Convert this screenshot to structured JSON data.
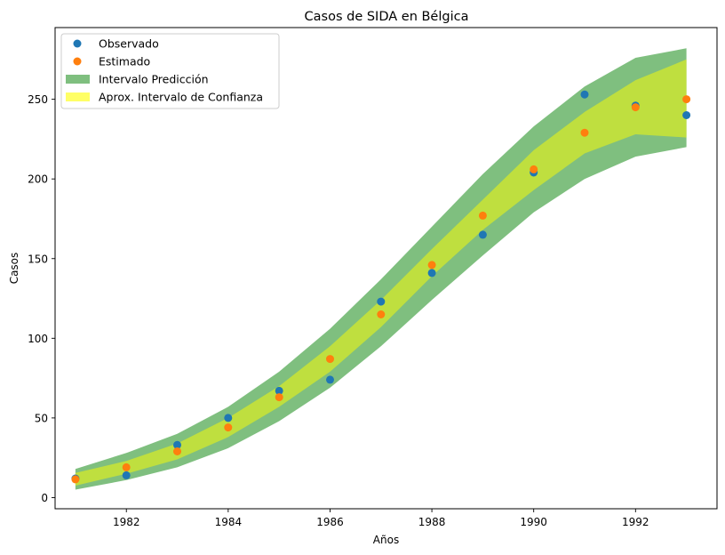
{
  "chart_data": {
    "type": "scatter",
    "title": "Casos de SIDA en Bélgica",
    "xlabel": "Años",
    "ylabel": "Casos",
    "xlim": [
      1980.6,
      1993.6
    ],
    "ylim": [
      -7,
      295
    ],
    "xticks": [
      1982,
      1984,
      1986,
      1988,
      1990,
      1992
    ],
    "yticks": [
      0,
      50,
      100,
      150,
      200,
      250
    ],
    "grid": false,
    "legend_position": "top-left",
    "x": [
      1981,
      1982,
      1983,
      1984,
      1985,
      1986,
      1987,
      1988,
      1989,
      1990,
      1991,
      1992,
      1993
    ],
    "series": [
      {
        "name": "Observado",
        "kind": "points",
        "color": "#1f77b4",
        "values": [
          12,
          14,
          33,
          50,
          67,
          74,
          123,
          141,
          165,
          204,
          253,
          246,
          240
        ]
      },
      {
        "name": "Estimado",
        "kind": "points",
        "color": "#ff7f0e",
        "values": [
          11.5,
          19,
          29,
          44,
          63,
          87,
          115,
          146,
          177,
          206,
          229,
          245,
          250
        ]
      }
    ],
    "bands": [
      {
        "name": "Intervalo Predicción",
        "color": "#7fbf7f",
        "lower": [
          5,
          11,
          19,
          31,
          48,
          69,
          95,
          124,
          152,
          179,
          200,
          214,
          220
        ],
        "upper": [
          18,
          28,
          40,
          57,
          79,
          106,
          137,
          170,
          203,
          233,
          258,
          276,
          282
        ]
      },
      {
        "name": "Aprox. Intervalo de Confianza",
        "color": "#ffff66",
        "blend_color": "#bfdf3f",
        "lower": [
          7.5,
          15,
          24,
          38,
          57,
          79,
          107,
          139,
          168,
          193,
          216,
          228,
          226
        ],
        "upper": [
          15.5,
          23,
          34,
          50,
          70,
          95,
          124,
          156,
          187,
          218,
          242,
          262,
          275
        ]
      }
    ],
    "legend": [
      {
        "label": "Observado",
        "marker": "point",
        "color": "#1f77b4"
      },
      {
        "label": "Estimado",
        "marker": "point",
        "color": "#ff7f0e"
      },
      {
        "label": "Intervalo Predicción",
        "marker": "patch",
        "color": "#7fbf7f"
      },
      {
        "label": "Aprox. Intervalo de Confianza",
        "marker": "patch",
        "color": "#ffff66"
      }
    ]
  }
}
